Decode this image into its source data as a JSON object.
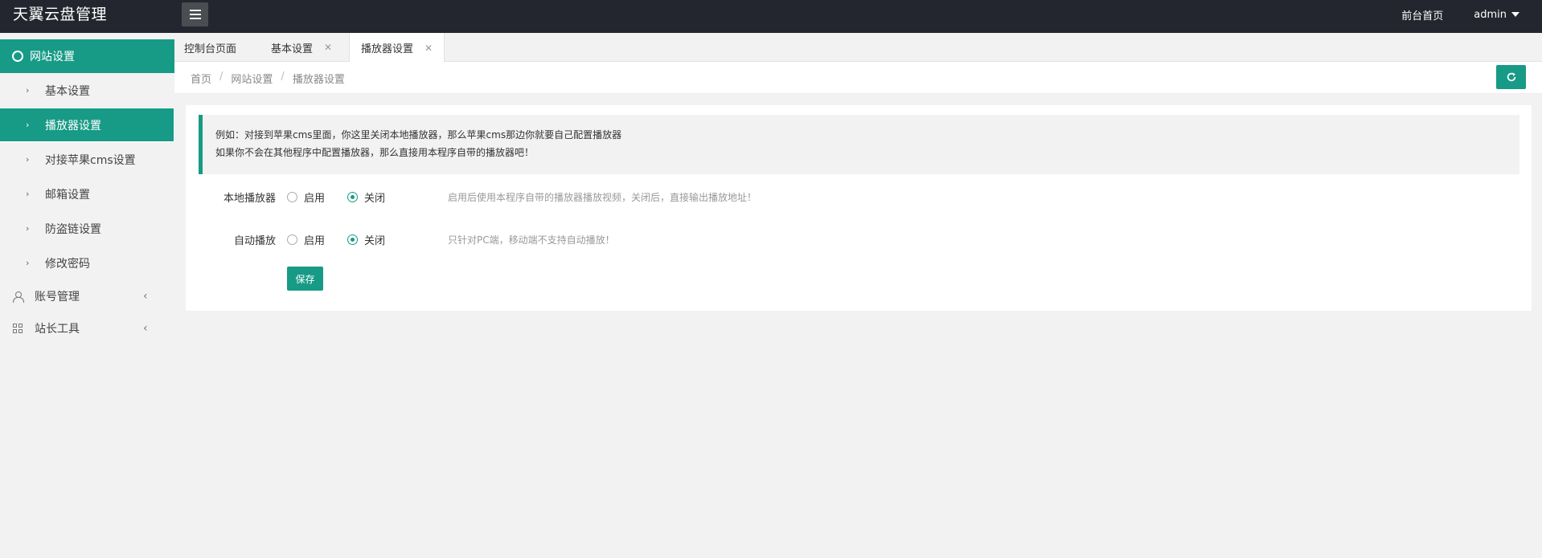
{
  "app": {
    "title": "天翼云盘管理"
  },
  "header": {
    "frontpage_link": "前台首页",
    "user": "admin"
  },
  "sidebar": {
    "active_group": "网站设置",
    "items": [
      {
        "label": "基本设置"
      },
      {
        "label": "播放器设置"
      },
      {
        "label": "对接苹果cms设置"
      },
      {
        "label": "邮箱设置"
      },
      {
        "label": "防盗链设置"
      },
      {
        "label": "修改密码"
      }
    ],
    "groups": [
      {
        "label": "账号管理"
      },
      {
        "label": "站长工具"
      }
    ]
  },
  "tabs": [
    {
      "label": "控制台页面"
    },
    {
      "label": "基本设置",
      "close": "✕"
    },
    {
      "label": "播放器设置",
      "close": "✕"
    }
  ],
  "breadcrumb": {
    "items": [
      "首页",
      "网站设置",
      "播放器设置"
    ],
    "separator": "/"
  },
  "notice": {
    "line1": "例如：对接到苹果cms里面，你这里关闭本地播放器，那么苹果cms那边你就要自己配置播放器",
    "line2": "如果你不会在其他程序中配置播放器，那么直接用本程序自带的播放器吧！"
  },
  "form": {
    "local_player": {
      "label": "本地播放器",
      "opt_on": "启用",
      "opt_off": "关闭",
      "selected": "关闭",
      "hint": "启用后使用本程序自带的播放器播放视频，关闭后，直接输出播放地址！"
    },
    "autoplay": {
      "label": "自动播放",
      "opt_on": "启用",
      "opt_off": "关闭",
      "selected": "关闭",
      "hint": "只针对PC端，移动端不支持自动播放！"
    },
    "save_label": "保存"
  },
  "colors": {
    "accent": "#179a86",
    "header_bg": "#23262e"
  }
}
